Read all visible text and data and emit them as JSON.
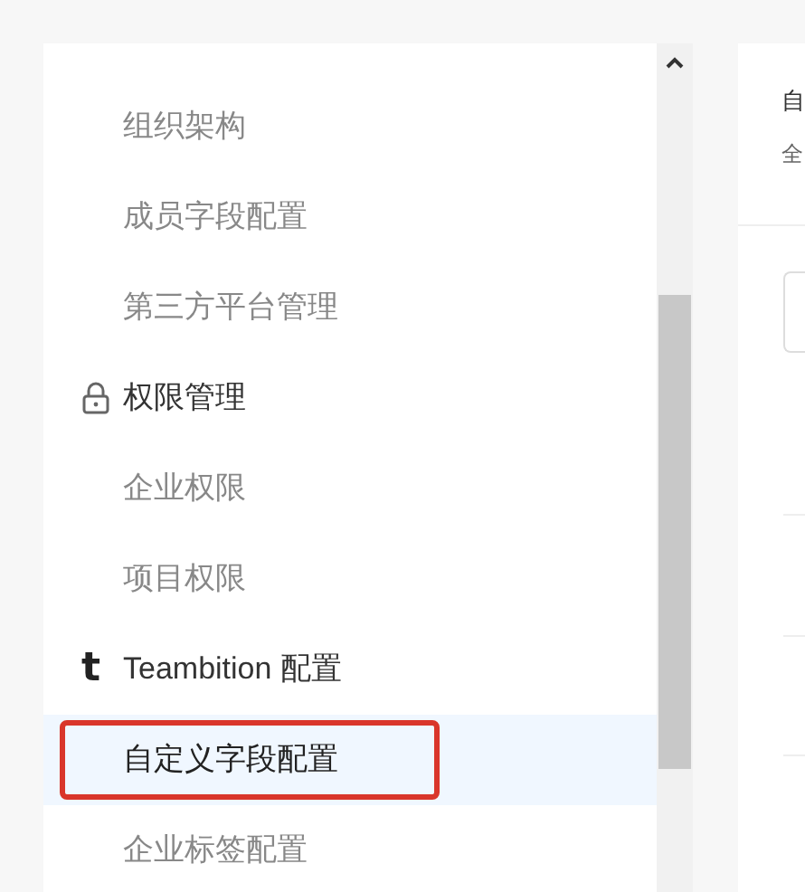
{
  "sidebar": {
    "items": [
      {
        "label": "组织架构",
        "kind": "item",
        "selected": false,
        "highlighted": false
      },
      {
        "label": "成员字段配置",
        "kind": "item",
        "selected": false,
        "highlighted": false
      },
      {
        "label": "第三方平台管理",
        "kind": "item",
        "selected": false,
        "highlighted": false
      },
      {
        "label": "权限管理",
        "kind": "lock-group",
        "selected": false,
        "highlighted": false
      },
      {
        "label": "企业权限",
        "kind": "item",
        "selected": false,
        "highlighted": false
      },
      {
        "label": "项目权限",
        "kind": "item",
        "selected": false,
        "highlighted": false
      },
      {
        "label": "Teambition 配置",
        "kind": "logo-group",
        "glyph": "t",
        "selected": false,
        "highlighted": false
      },
      {
        "label": "自定义字段配置",
        "kind": "item",
        "selected": true,
        "highlighted": true
      },
      {
        "label": "企业标签配置",
        "kind": "item",
        "selected": false,
        "highlighted": false
      }
    ]
  },
  "content": {
    "title": "自",
    "subtitle": "全"
  }
}
